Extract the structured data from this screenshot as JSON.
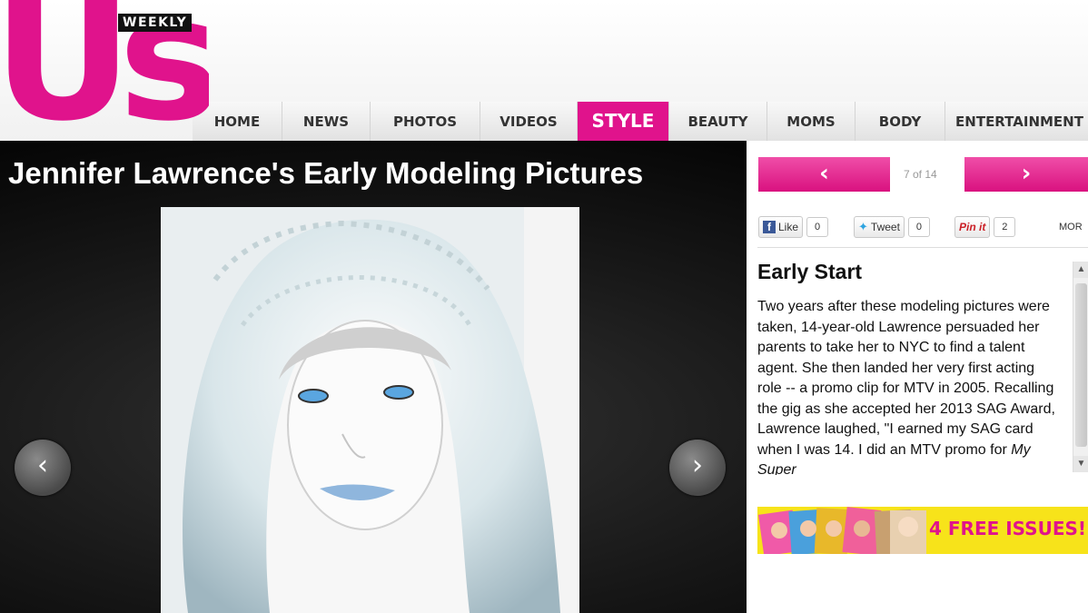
{
  "brand": {
    "logo_text": "Us",
    "weekly_label": "WEEKLY",
    "accent_color": "#e0138c"
  },
  "nav": {
    "items": [
      {
        "label": "HOME",
        "active": false
      },
      {
        "label": "NEWS",
        "active": false
      },
      {
        "label": "PHOTOS",
        "active": false
      },
      {
        "label": "VIDEOS",
        "active": false
      },
      {
        "label": "STYLE",
        "active": true
      },
      {
        "label": "BEAUTY",
        "active": false
      },
      {
        "label": "MOMS",
        "active": false
      },
      {
        "label": "BODY",
        "active": false
      },
      {
        "label": "ENTERTAINMENT",
        "active": false
      }
    ]
  },
  "gallery": {
    "title": "Jennifer Lawrence's Early Modeling Pictures",
    "prev_icon": "chevron-left-icon",
    "next_icon": "chevron-right-icon"
  },
  "pagination": {
    "counter": "7 of 14",
    "prev_icon": "arrow-left-icon",
    "next_icon": "arrow-right-icon"
  },
  "share": {
    "facebook": {
      "label": "Like",
      "count": "0"
    },
    "twitter": {
      "label": "Tweet",
      "count": "0"
    },
    "pinterest": {
      "label": "Pin it",
      "count": "2"
    },
    "more_label": "MOR"
  },
  "caption": {
    "title": "Early Start",
    "text_before_italic": "Two years after these modeling pictures were taken, 14-year-old Lawrence persuaded her parents to take her to NYC to find a talent agent. She then landed her very first acting role -- a promo clip for MTV in 2005. Recalling the gig as she accepted her 2013 SAG Award, Lawrence laughed, \"I earned my SAG card when I was 14. I did an MTV promo for ",
    "text_italic": "My Super"
  },
  "promo": {
    "label": "4 FREE ISSUES!"
  }
}
